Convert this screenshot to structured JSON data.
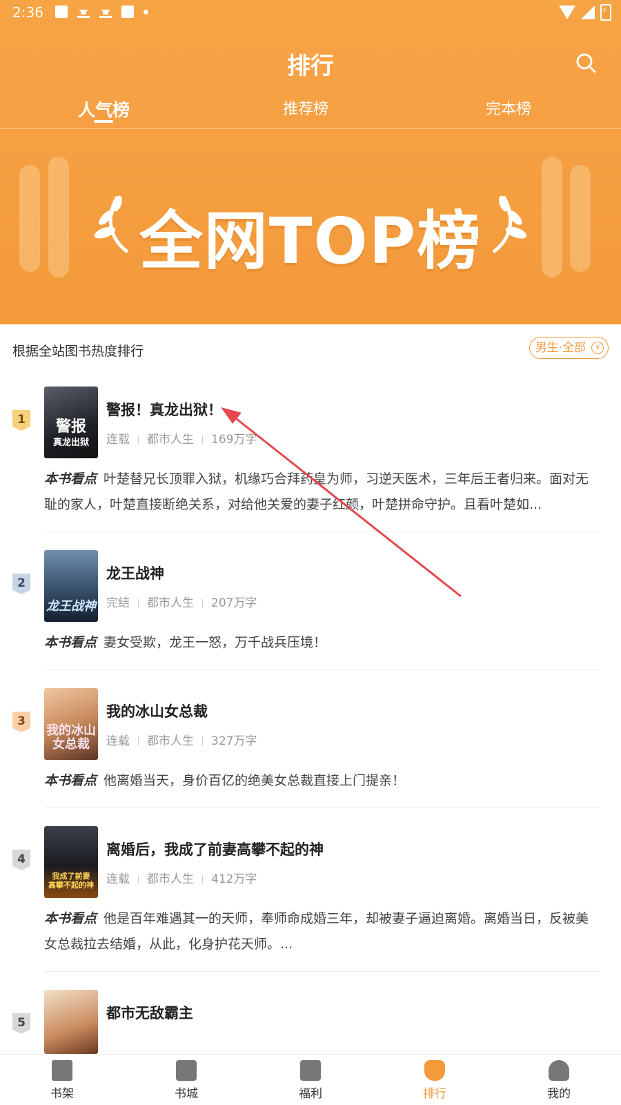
{
  "status": {
    "time": "2:36"
  },
  "header": {
    "title": "排行",
    "search_icon": "search-icon"
  },
  "tabs": [
    {
      "label": "人气榜",
      "active": true
    },
    {
      "label": "推荐榜",
      "active": false
    },
    {
      "label": "完本榜",
      "active": false
    }
  ],
  "banner": {
    "title": "全网TOP榜"
  },
  "list_header": {
    "subtitle": "根据全站图书热度排行",
    "filter": "男生·全部"
  },
  "books": [
    {
      "rank": "1",
      "title": "警报！真龙出狱！",
      "cover_text": "警报\n真龙出狱",
      "status": "连载",
      "category": "都市人生",
      "words": "169万字",
      "summary_label": "本书看点",
      "summary": "叶楚替兄长顶罪入狱，机缘巧合拜药皇为师，习逆天医术，三年后王者归来。面对无耻的家人，叶楚直接断绝关系，对给他关爱的妻子红颜，叶楚拼命守护。且看叶楚如..."
    },
    {
      "rank": "2",
      "title": "龙王战神",
      "cover_text": "龙王战神",
      "status": "完结",
      "category": "都市人生",
      "words": "207万字",
      "summary_label": "本书看点",
      "summary": "妻女受欺，龙王一怒，万千战兵压境！"
    },
    {
      "rank": "3",
      "title": "我的冰山女总裁",
      "cover_text": "我的冰山\n女总裁",
      "status": "连载",
      "category": "都市人生",
      "words": "327万字",
      "summary_label": "本书看点",
      "summary": "他离婚当天，身价百亿的绝美女总裁直接上门提亲！"
    },
    {
      "rank": "4",
      "title": "离婚后，我成了前妻高攀不起的神",
      "cover_text": "我成了前妻\n高攀不起的神",
      "status": "连载",
      "category": "都市人生",
      "words": "412万字",
      "summary_label": "本书看点",
      "summary": "他是百年难遇其一的天师，奉师命成婚三年，却被妻子逼迫离婚。离婚当日，反被美女总裁拉去结婚，从此，化身护花天师。..."
    },
    {
      "rank": "5",
      "title": "都市无敌霸主"
    }
  ],
  "bottom_nav": [
    {
      "label": "书架",
      "active": false
    },
    {
      "label": "书城",
      "active": false
    },
    {
      "label": "福利",
      "active": false
    },
    {
      "label": "排行",
      "active": true
    },
    {
      "label": "我的",
      "active": false
    }
  ],
  "colors": {
    "accent": "#f39a3a",
    "arrow": "#e5484d"
  }
}
